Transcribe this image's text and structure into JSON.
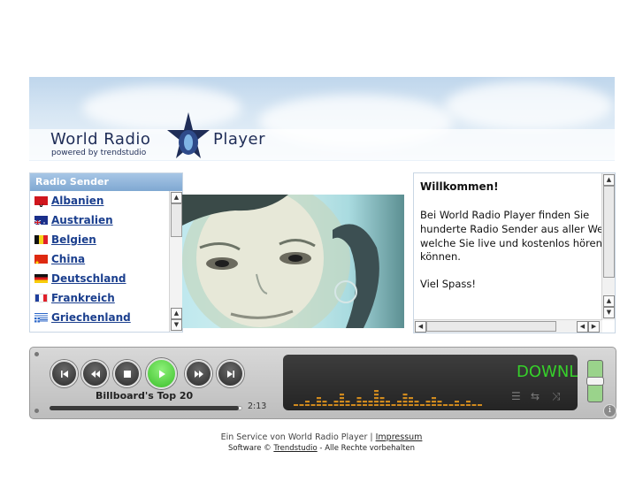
{
  "brand": {
    "word1": "World Radio",
    "word2": "Player",
    "tagline": "powered by trendstudio"
  },
  "sender": {
    "title": "Radio Sender",
    "items": [
      {
        "label": "Albanien",
        "flag": "albania-flag"
      },
      {
        "label": "Australien",
        "flag": "australia-flag"
      },
      {
        "label": "Belgien",
        "flag": "belgium-flag"
      },
      {
        "label": "China",
        "flag": "china-flag"
      },
      {
        "label": "Deutschland",
        "flag": "germany-flag"
      },
      {
        "label": "Frankreich",
        "flag": "france-flag"
      },
      {
        "label": "Griechenland",
        "flag": "greece-flag"
      }
    ]
  },
  "welcome": {
    "title": "Willkommen!",
    "lines": [
      "Bei World Radio Player finden Sie",
      "hunderte Radio Sender aus aller We",
      "welche Sie live und kostenlos hören",
      "können.",
      "Viel Spass!"
    ]
  },
  "player": {
    "track": "Billboard's Top 20",
    "time": "2:13",
    "progress": 0.98,
    "display_text": "DOWNL",
    "volume_level": 0.5,
    "colors": {
      "display_text": "#36d02a",
      "eq": "#d08a1e",
      "play": "#3bbf2a"
    }
  },
  "footer": {
    "line1_prefix": "Ein Service von World Radio Player | ",
    "impressum": "Impressum",
    "line2_prefix": "Software © ",
    "trendstudio": "Trendstudio",
    "line2_suffix": " - Alle Rechte vorbehalten"
  }
}
